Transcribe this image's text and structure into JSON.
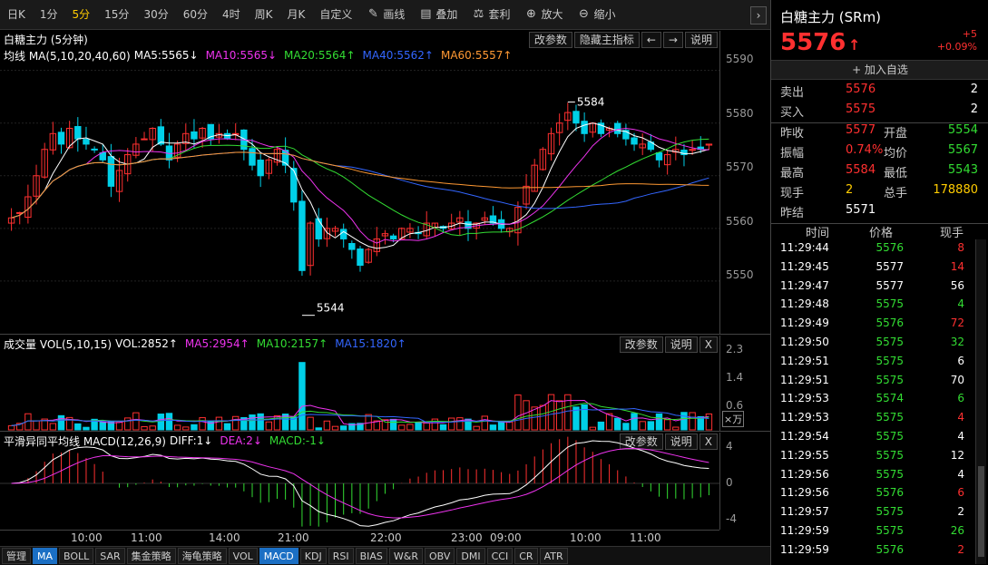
{
  "toolbar": {
    "periods": [
      "日K",
      "1分",
      "5分",
      "15分",
      "30分",
      "60分",
      "4时",
      "周K",
      "月K",
      "自定义"
    ],
    "active_period": "5分",
    "tools": [
      {
        "label": "画线",
        "icon": "pencil-icon"
      },
      {
        "label": "叠加",
        "icon": "overlay-icon"
      },
      {
        "label": "套利",
        "icon": "arbitrage-icon"
      },
      {
        "label": "放大",
        "icon": "zoom-in-icon"
      },
      {
        "label": "缩小",
        "icon": "zoom-out-icon"
      }
    ],
    "collapse": "›"
  },
  "main_panel": {
    "title": "白糖主力 (5分钟)",
    "buttons": [
      "改参数",
      "隐藏主指标",
      "←",
      "→",
      "说明"
    ],
    "ma_line": {
      "label": "均线 MA(5,10,20,40,60)",
      "items": [
        {
          "text": "MA5:5565↓",
          "color": "#ffffff"
        },
        {
          "text": "MA10:5565↓",
          "color": "#ee33ee"
        },
        {
          "text": "MA20:5564↑",
          "color": "#33dd33"
        },
        {
          "text": "MA40:5562↑",
          "color": "#3366ff"
        },
        {
          "text": "MA60:5557↑",
          "color": "#ff9933"
        }
      ]
    },
    "y_ticks": [
      "5590",
      "5580",
      "5570",
      "5560",
      "5550"
    ],
    "annotations": {
      "high": "5584",
      "low": "5544"
    }
  },
  "vol_panel": {
    "title": "成交量 VOL(5,10,15)",
    "items": [
      {
        "text": "VOL:2852↑",
        "color": "#ffffff"
      },
      {
        "text": "MA5:2954↑",
        "color": "#ee33ee"
      },
      {
        "text": "MA10:2157↑",
        "color": "#33dd33"
      },
      {
        "text": "MA15:1820↑",
        "color": "#3366ff"
      }
    ],
    "buttons": [
      "改参数",
      "说明",
      "X"
    ],
    "y_ticks": [
      "2.3",
      "1.4",
      "0.6"
    ],
    "unit": "×万"
  },
  "macd_panel": {
    "title": "平滑异同平均线 MACD(12,26,9)",
    "items": [
      {
        "text": "DIFF:1↓",
        "color": "#ffffff"
      },
      {
        "text": "DEA:2↓",
        "color": "#ee33ee"
      },
      {
        "text": "MACD:-1↓",
        "color": "#33dd33"
      }
    ],
    "buttons": [
      "改参数",
      "说明",
      "X"
    ],
    "y_ticks": [
      "4",
      "0",
      "-4"
    ]
  },
  "time_axis": [
    "10:00",
    "11:00",
    "14:00",
    "21:00",
    "22:00",
    "23:00",
    "09:00",
    "10:00",
    "11:00"
  ],
  "indicator_tabs": [
    "管理",
    "MA",
    "BOLL",
    "SAR",
    "集金策略",
    "海龟策略",
    "VOL",
    "MACD",
    "KDJ",
    "RSI",
    "BIAS",
    "W&R",
    "OBV",
    "DMI",
    "CCI",
    "CR",
    "ATR"
  ],
  "active_tabs": [
    "MA",
    "MACD"
  ],
  "quote": {
    "title": "白糖主力 (SRm)",
    "price": "5576",
    "arrow": "↑",
    "change": "+5",
    "change_pct": "+0.09%",
    "add_watch": "+ 加入自选",
    "book": [
      {
        "label": "卖出",
        "price": "5576",
        "qty": "2"
      },
      {
        "label": "买入",
        "price": "5575",
        "qty": "2"
      }
    ],
    "stats": [
      {
        "l1": "昨收",
        "v1": "5577",
        "c1": "red",
        "l2": "开盘",
        "v2": "5554",
        "c2": "green"
      },
      {
        "l1": "振幅",
        "v1": "0.74%",
        "c1": "red",
        "l2": "均价",
        "v2": "5567",
        "c2": "green"
      },
      {
        "l1": "最高",
        "v1": "5584",
        "c1": "red",
        "l2": "最低",
        "v2": "5543",
        "c2": "green"
      },
      {
        "l1": "现手",
        "v1": "2",
        "c1": "yellow",
        "l2": "总手",
        "v2": "178880",
        "c2": "yellow"
      },
      {
        "l1": "昨结",
        "v1": "5571",
        "c1": "white",
        "l2": "",
        "v2": "",
        "c2": "white"
      }
    ],
    "ticks_header": [
      "时间",
      "价格",
      "现手"
    ],
    "ticks": [
      {
        "time": "11:29:44",
        "price": "5576",
        "vol": "8",
        "vc": "red"
      },
      {
        "time": "11:29:45",
        "price": "5577",
        "vol": "14",
        "vc": "red",
        "pc": "white"
      },
      {
        "time": "11:29:47",
        "price": "5577",
        "vol": "56",
        "vc": "white",
        "pc": "white"
      },
      {
        "time": "11:29:48",
        "price": "5575",
        "vol": "4",
        "vc": "green"
      },
      {
        "time": "11:29:49",
        "price": "5576",
        "vol": "72",
        "vc": "red"
      },
      {
        "time": "11:29:50",
        "price": "5575",
        "vol": "32",
        "vc": "green"
      },
      {
        "time": "11:29:51",
        "price": "5575",
        "vol": "6",
        "vc": "white"
      },
      {
        "time": "11:29:51",
        "price": "5575",
        "vol": "70",
        "vc": "white"
      },
      {
        "time": "11:29:53",
        "price": "5574",
        "vol": "6",
        "vc": "green"
      },
      {
        "time": "11:29:53",
        "price": "5575",
        "vol": "4",
        "vc": "red"
      },
      {
        "time": "11:29:54",
        "price": "5575",
        "vol": "4",
        "vc": "white"
      },
      {
        "time": "11:29:55",
        "price": "5575",
        "vol": "12",
        "vc": "white"
      },
      {
        "time": "11:29:56",
        "price": "5575",
        "vol": "4",
        "vc": "white"
      },
      {
        "time": "11:29:56",
        "price": "5576",
        "vol": "6",
        "vc": "red"
      },
      {
        "time": "11:29:57",
        "price": "5575",
        "vol": "2",
        "vc": "white"
      },
      {
        "time": "11:29:59",
        "price": "5575",
        "vol": "26",
        "vc": "green"
      },
      {
        "time": "11:29:59",
        "price": "5576",
        "vol": "2",
        "vc": "red"
      }
    ]
  },
  "chart_data": {
    "type": "candlestick",
    "ylim": [
      5540,
      5592
    ],
    "close_series": [
      5562,
      5563,
      5566,
      5570,
      5575,
      5578,
      5576,
      5579,
      5577,
      5576,
      5575,
      5573,
      5568,
      5571,
      5574,
      5576,
      5577,
      5579,
      5576,
      5573,
      5576,
      5578,
      5577,
      5579,
      5577,
      5578,
      5577,
      5578,
      5575,
      5572,
      5570,
      5573,
      5575,
      5572,
      5565,
      5552,
      5561,
      5558,
      5560,
      5560,
      5558,
      5556,
      5553,
      5556,
      5558,
      5559,
      5558,
      5560,
      5560,
      5559,
      5561,
      5561,
      5560,
      5561,
      5562,
      5560,
      5561,
      5562,
      5561,
      5560,
      5560,
      5564,
      5568,
      5572,
      5575,
      5578,
      5580,
      5582,
      5580,
      5578,
      5580,
      5578,
      5579,
      5578,
      5577,
      5576,
      5576,
      5575,
      5573,
      5574,
      5575,
      5574,
      5575,
      5575,
      5576
    ]
  }
}
